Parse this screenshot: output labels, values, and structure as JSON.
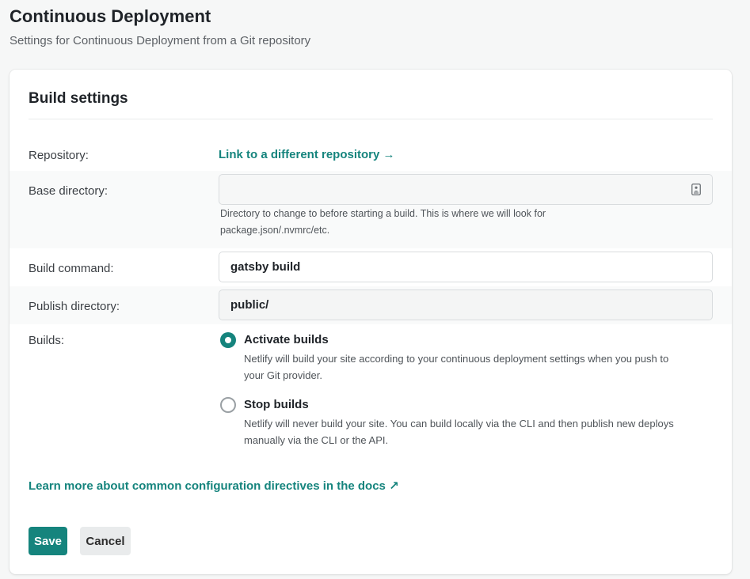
{
  "header": {
    "title": "Continuous Deployment",
    "subtitle": "Settings for Continuous Deployment from a Git repository"
  },
  "card": {
    "title": "Build settings"
  },
  "repository": {
    "label": "Repository:",
    "link_text": "Link to a different repository →"
  },
  "base_directory": {
    "label": "Base directory:",
    "value": "",
    "help_line1": "Directory to change to before starting a build. This is where we will look for",
    "help_line2": "package.json/.nvmrc/etc."
  },
  "build_command": {
    "label": "Build command:",
    "value": "gatsby build"
  },
  "publish_directory": {
    "label": "Publish directory:",
    "value": "public/"
  },
  "builds": {
    "label": "Builds:",
    "options": [
      {
        "title": "Activate builds",
        "desc_line1": "Netlify will build your site according to your continuous deployment settings when you push to",
        "desc_line2": "your Git provider.",
        "selected": true
      },
      {
        "title": "Stop builds",
        "desc_line1": "Netlify will never build your site. You can build locally via the CLI and then publish new deploys",
        "desc_line2": "manually via the CLI or the API.",
        "selected": false
      }
    ]
  },
  "docs_link": "Learn more about common configuration directives in the docs ↗",
  "actions": {
    "save_label": "Save",
    "cancel_label": "Cancel"
  },
  "colors": {
    "accent": "#15847d",
    "background": "#f6f7f7",
    "card": "#ffffff"
  },
  "icons": {
    "base_directory_field": "contact-card-icon"
  }
}
